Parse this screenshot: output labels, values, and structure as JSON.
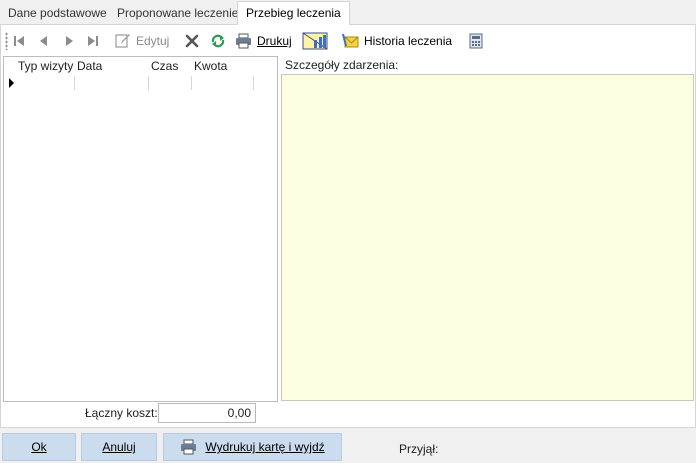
{
  "tabs": [
    {
      "label": "Dane podstawowe",
      "active": false
    },
    {
      "label": "Proponowane leczenie",
      "active": false
    },
    {
      "label": "Przebieg leczenia",
      "active": true
    }
  ],
  "toolbar": {
    "edit_label": "Edytuj",
    "print_label": "Drukuj",
    "history_label": "Historia leczenia"
  },
  "grid": {
    "columns": [
      "Typ wizyty",
      "Data",
      "Czas",
      "Kwota"
    ],
    "rows": []
  },
  "details": {
    "label": "Szczegóły zdarzenia:",
    "value": ""
  },
  "cost": {
    "label": "Łączny koszt:",
    "value": "0,00"
  },
  "footer": {
    "ok_label": "Ok",
    "cancel_label": "Anuluj",
    "print_exit_label": "Wydrukuj kartę i wyjdź",
    "received_label": "Przyjął:"
  },
  "colors": {
    "details_background": "#fdfde1",
    "button_background": "#cbdcef"
  }
}
